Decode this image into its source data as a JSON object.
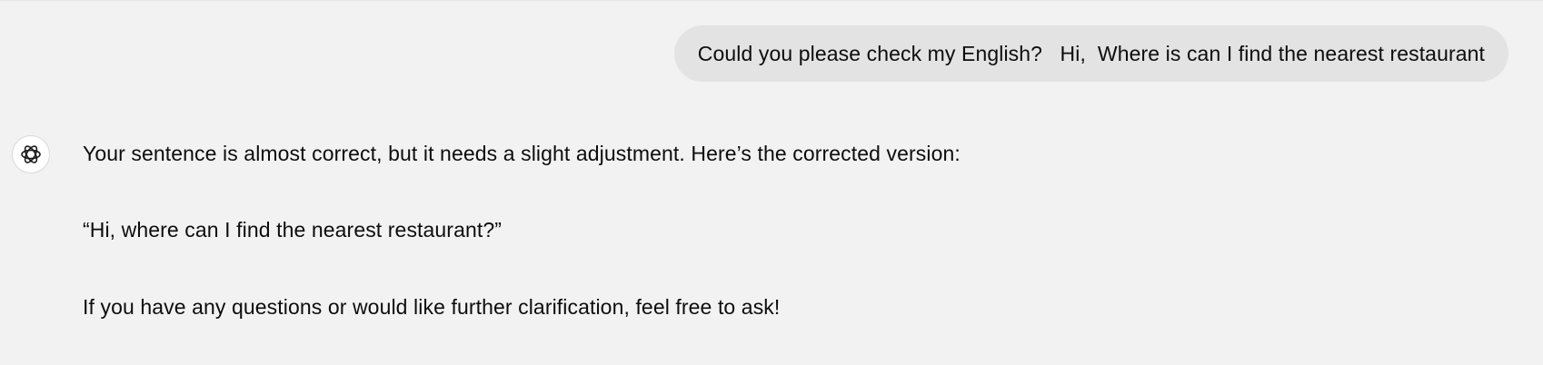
{
  "user_message": {
    "text": "Could you please check my English?   Hi,  Where is can I find the nearest restaurant"
  },
  "assistant_message": {
    "avatar_icon": "openai-logo-icon",
    "paragraphs": [
      "Your sentence is almost correct, but it needs a slight adjustment. Here’s the corrected version:",
      "“Hi, where can I find the nearest restaurant?”",
      "If you have any questions or would like further clarification, feel free to ask!"
    ]
  },
  "colors": {
    "background": "#f2f2f2",
    "user_bubble": "#e3e3e3",
    "text": "#0d0d0d"
  }
}
